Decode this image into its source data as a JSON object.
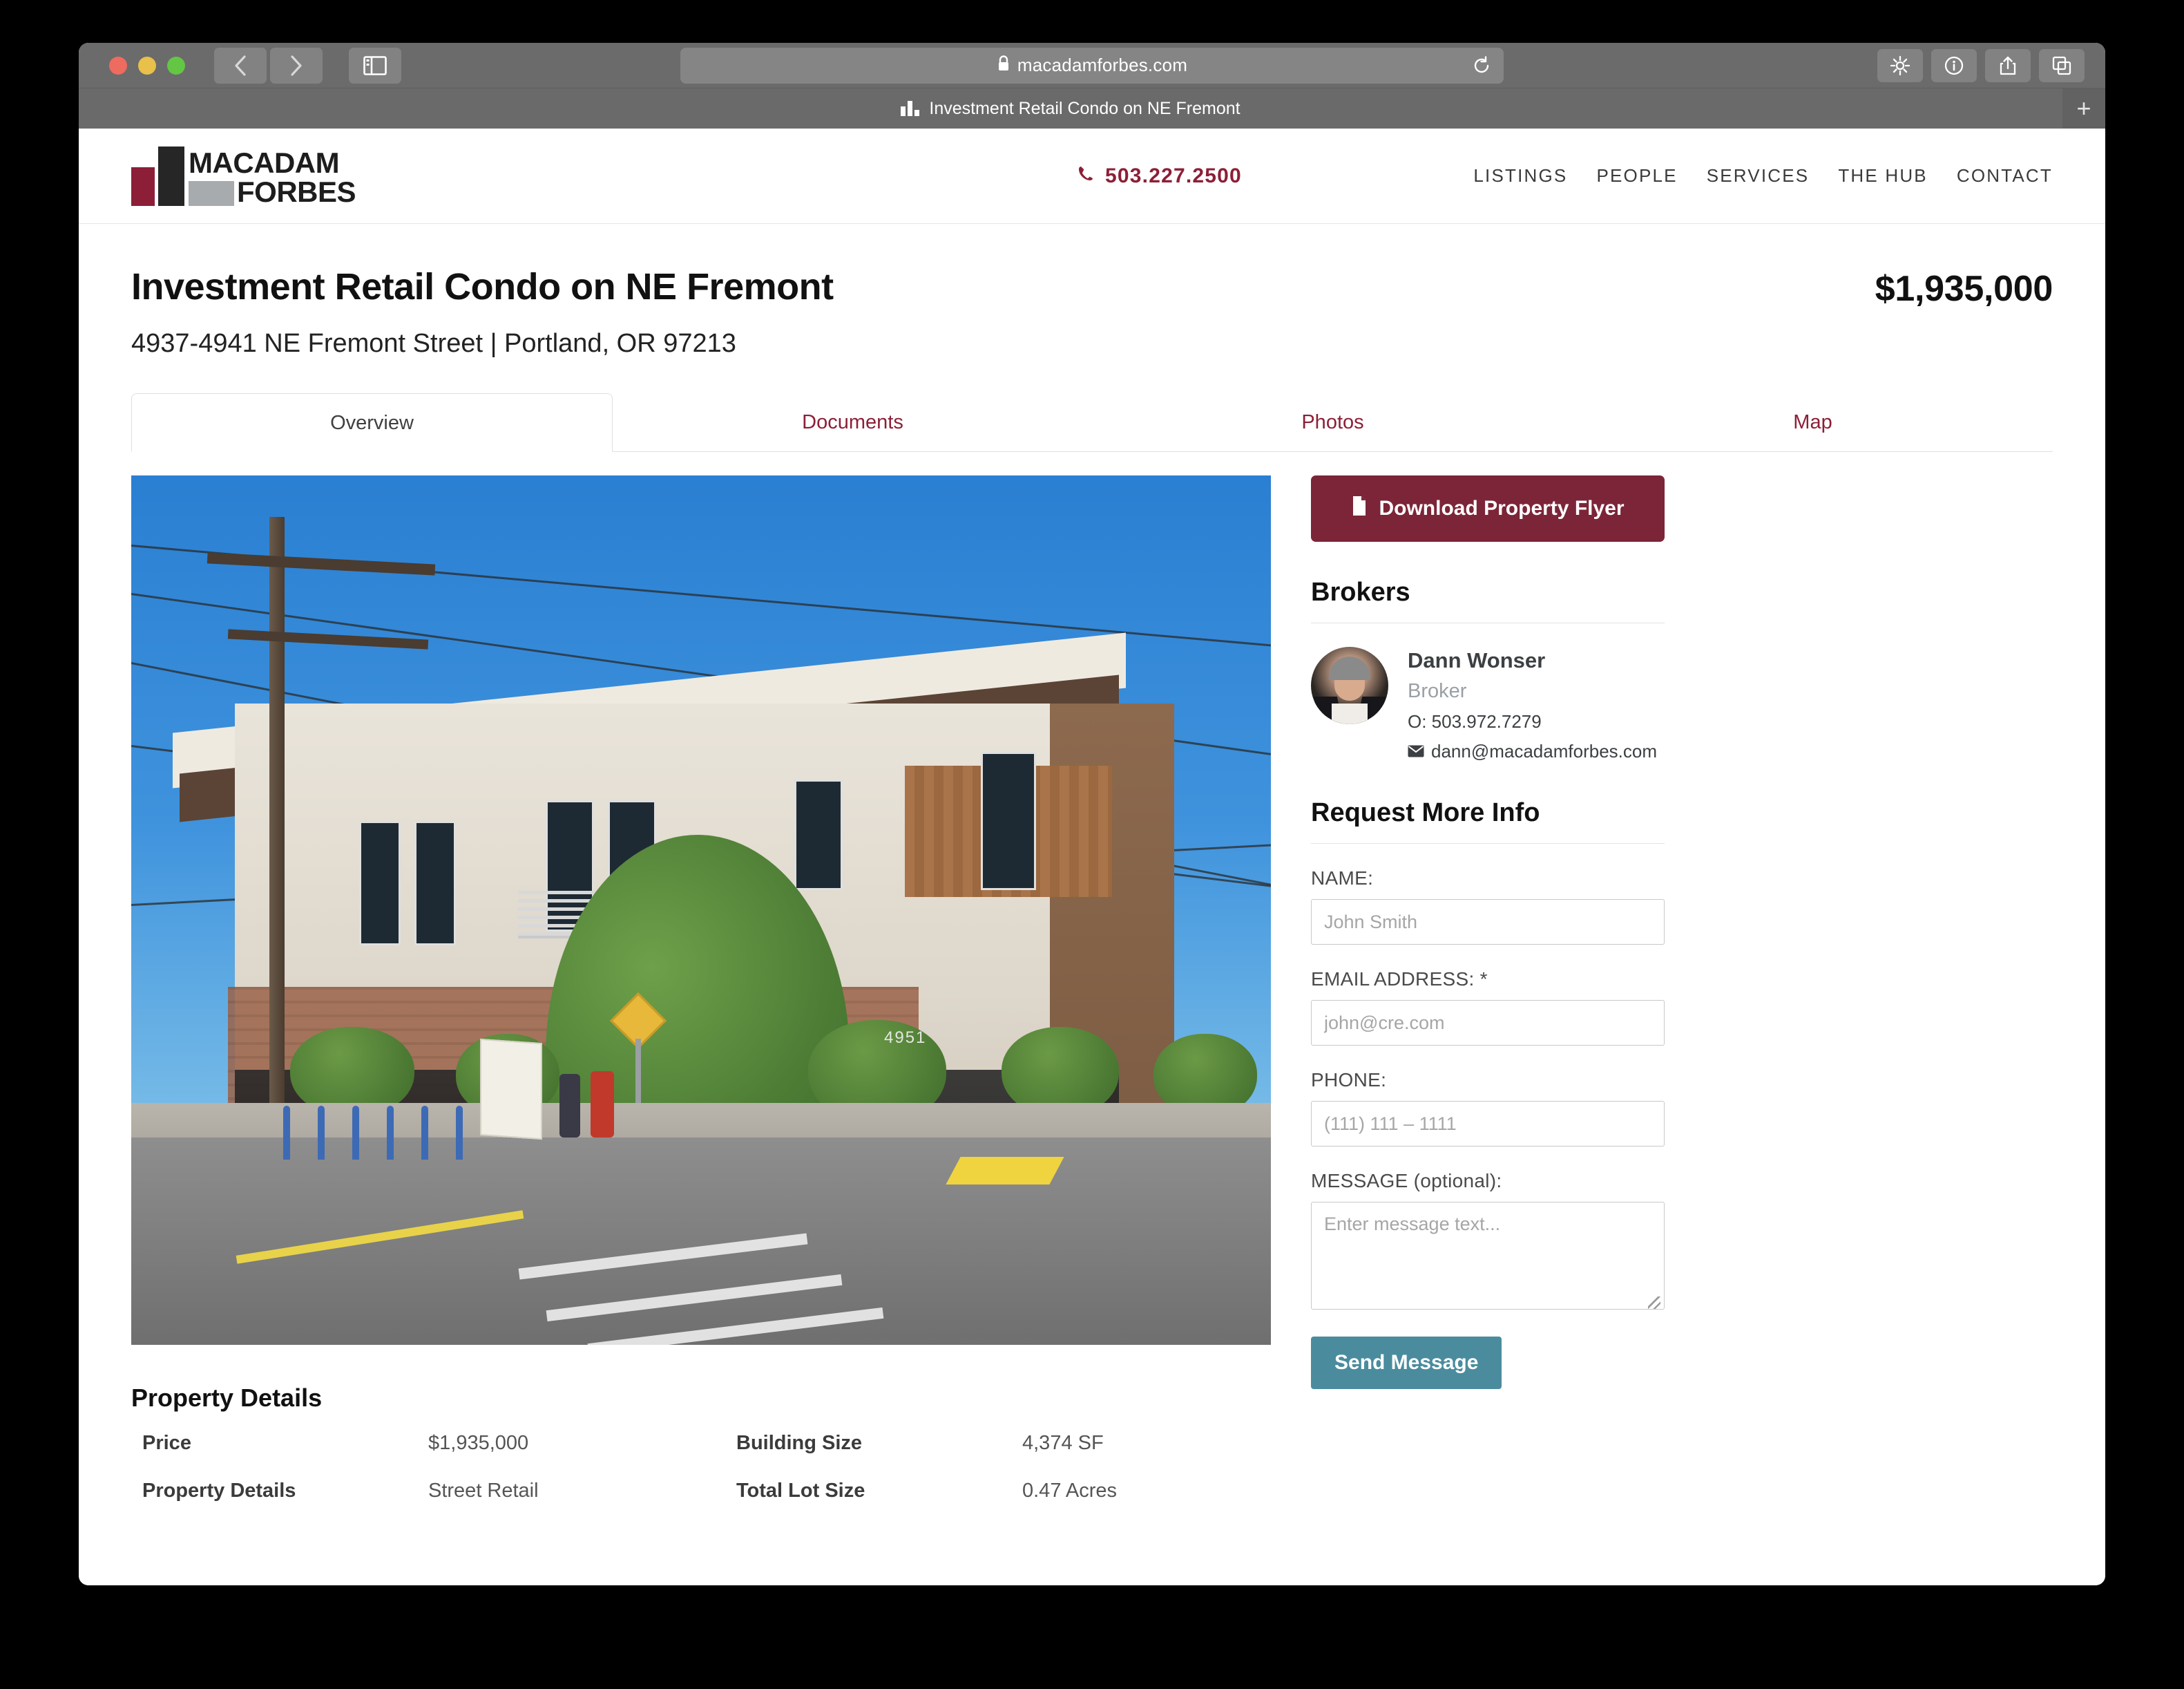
{
  "browser": {
    "url": "macadamforbes.com",
    "lock_icon": "lock-icon",
    "reload_icon": "reload-icon",
    "back_icon": "chevron-left-icon",
    "forward_icon": "chevron-right-icon",
    "sidebar_icon": "sidebar-toggle-icon",
    "tools": [
      {
        "name": "gear-icon",
        "label": "Settings"
      },
      {
        "name": "info-icon",
        "label": "Info"
      },
      {
        "name": "share-icon",
        "label": "Share"
      },
      {
        "name": "tabs-icon",
        "label": "Show Tabs"
      }
    ],
    "tab_title": "Investment Retail Condo on NE Fremont",
    "new_tab_label": "+"
  },
  "site": {
    "logo": {
      "line1": "MACADAM",
      "line2": "FORBES",
      "maroon": "#8c1f37",
      "black": "#262626",
      "gray": "#a8abae"
    },
    "phone": "503.227.2500",
    "phone_icon": "phone-icon",
    "nav": [
      {
        "label": "LISTINGS"
      },
      {
        "label": "PEOPLE"
      },
      {
        "label": "SERVICES"
      },
      {
        "label": "THE HUB"
      },
      {
        "label": "CONTACT"
      }
    ]
  },
  "listing": {
    "title": "Investment Retail Condo on NE Fremont",
    "price": "$1,935,000",
    "address": "4937-4941 NE Fremont Street | Portland, OR 97213",
    "tabs": [
      {
        "label": "Overview",
        "active": true
      },
      {
        "label": "Documents",
        "active": false
      },
      {
        "label": "Photos",
        "active": false
      },
      {
        "label": "Map",
        "active": false
      }
    ],
    "photo_address_number": "4951"
  },
  "property_details": {
    "heading": "Property Details",
    "rows": [
      {
        "label": "Price",
        "value": "$1,935,000",
        "label2": "Building Size",
        "value2": "4,374 SF"
      },
      {
        "label": "Property Details",
        "value": "Street Retail",
        "label2": "Total Lot Size",
        "value2": "0.47 Acres"
      }
    ]
  },
  "sidebar": {
    "flyer_button": "Download Property Flyer",
    "flyer_icon": "document-icon",
    "brokers_heading": "Brokers",
    "broker": {
      "name": "Dann Wonser",
      "role": "Broker",
      "phone": "O: 503.972.7279",
      "email": "dann@macadamforbes.com",
      "email_icon": "envelope-icon"
    },
    "form": {
      "heading": "Request More Info",
      "name_label": "NAME:",
      "name_placeholder": "John Smith",
      "email_label": "EMAIL ADDRESS: *",
      "email_placeholder": "john@cre.com",
      "phone_label": "PHONE:",
      "phone_placeholder": "(111) 111 – 1111",
      "message_label": "MESSAGE (optional):",
      "message_placeholder": "Enter message text...",
      "submit_label": "Send Message"
    }
  },
  "colors": {
    "brand_maroon": "#8c1f37",
    "flyer_button": "#7c2538",
    "send_button": "#4a8c9e"
  }
}
